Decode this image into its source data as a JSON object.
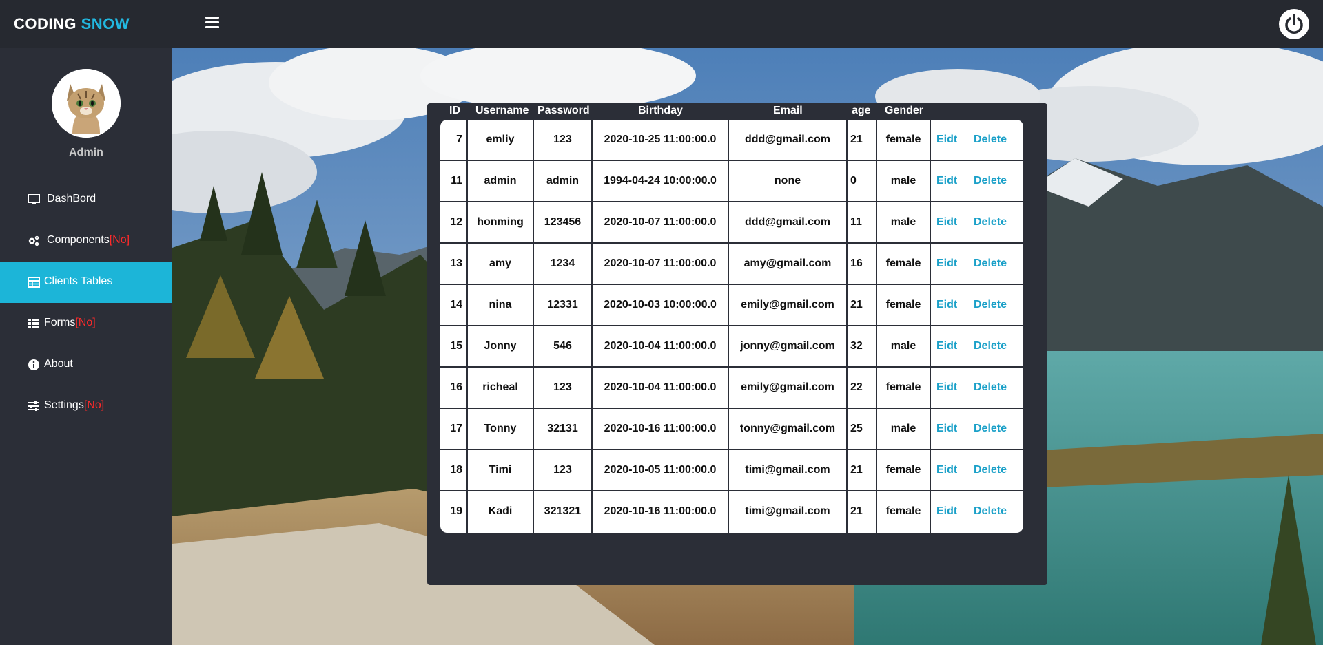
{
  "brand": {
    "part1": "CODING",
    "part2": "SNOW"
  },
  "sidebar": {
    "user_name": "Admin",
    "items": [
      {
        "label": "DashBord",
        "suffix": "",
        "icon": "monitor-icon"
      },
      {
        "label": "Components",
        "suffix": "[No]",
        "icon": "gears-icon"
      },
      {
        "label": "Clients Tables",
        "suffix": "",
        "icon": "table-icon"
      },
      {
        "label": "Forms",
        "suffix": "[No]",
        "icon": "grid-icon"
      },
      {
        "label": "About",
        "suffix": "",
        "icon": "info-icon"
      },
      {
        "label": "Settings",
        "suffix": "[No]",
        "icon": "sliders-icon"
      }
    ]
  },
  "table": {
    "headers": [
      "ID",
      "Username",
      "Password",
      "Birthday",
      "Email",
      "age",
      "Gender"
    ],
    "edit_label": "Eidt",
    "delete_label": "Delete",
    "rows": [
      {
        "id": "7",
        "username": "emliy",
        "password": "123",
        "birthday": "2020-10-25 11:00:00.0",
        "email": "ddd@gmail.com",
        "age": "21",
        "gender": "female"
      },
      {
        "id": "11",
        "username": "admin",
        "password": "admin",
        "birthday": "1994-04-24 10:00:00.0",
        "email": "none",
        "age": "0",
        "gender": "male"
      },
      {
        "id": "12",
        "username": "honming",
        "password": "123456",
        "birthday": "2020-10-07 11:00:00.0",
        "email": "ddd@gmail.com",
        "age": "11",
        "gender": "male"
      },
      {
        "id": "13",
        "username": "amy",
        "password": "1234",
        "birthday": "2020-10-07 11:00:00.0",
        "email": "amy@gmail.com",
        "age": "16",
        "gender": "female"
      },
      {
        "id": "14",
        "username": "nina",
        "password": "12331",
        "birthday": "2020-10-03 10:00:00.0",
        "email": "emily@gmail.com",
        "age": "21",
        "gender": "female"
      },
      {
        "id": "15",
        "username": "Jonny",
        "password": "546",
        "birthday": "2020-10-04 11:00:00.0",
        "email": "jonny@gmail.com",
        "age": "32",
        "gender": "male"
      },
      {
        "id": "16",
        "username": "richeal",
        "password": "123",
        "birthday": "2020-10-04 11:00:00.0",
        "email": "emily@gmail.com",
        "age": "22",
        "gender": "female"
      },
      {
        "id": "17",
        "username": "Tonny",
        "password": "32131",
        "birthday": "2020-10-16 11:00:00.0",
        "email": "tonny@gmail.com",
        "age": "25",
        "gender": "male"
      },
      {
        "id": "18",
        "username": "Timi",
        "password": "123",
        "birthday": "2020-10-05 11:00:00.0",
        "email": "timi@gmail.com",
        "age": "21",
        "gender": "female"
      },
      {
        "id": "19",
        "username": "Kadi",
        "password": "321321",
        "birthday": "2020-10-16 11:00:00.0",
        "email": "timi@gmail.com",
        "age": "21",
        "gender": "female"
      }
    ]
  },
  "colors": {
    "accent": "#1cb5d8",
    "link": "#1aa0c8",
    "warning": "#ff2a2a",
    "sidebar": "#2b2e37"
  }
}
